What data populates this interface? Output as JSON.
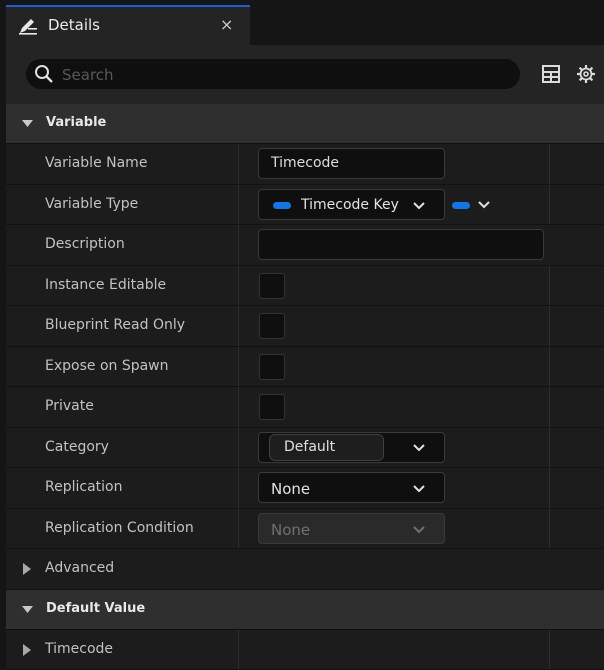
{
  "tab": {
    "title": "Details",
    "close": "×"
  },
  "search": {
    "placeholder": "Search",
    "value": ""
  },
  "sections": {
    "variable": "Variable",
    "default_value": "Default Value"
  },
  "rows": {
    "variable_name": {
      "label": "Variable Name",
      "value": "Timecode"
    },
    "variable_type": {
      "label": "Variable Type",
      "value": "Timecode Key",
      "pin_color": "#1476e6"
    },
    "description": {
      "label": "Description",
      "value": ""
    },
    "instance_editable": {
      "label": "Instance Editable",
      "checked": false
    },
    "blueprint_read_only": {
      "label": "Blueprint Read Only",
      "checked": false
    },
    "expose_on_spawn": {
      "label": "Expose on Spawn",
      "checked": false
    },
    "private": {
      "label": "Private",
      "checked": false
    },
    "category": {
      "label": "Category",
      "value": "Default"
    },
    "replication": {
      "label": "Replication",
      "value": "None"
    },
    "replication_condition": {
      "label": "Replication Condition",
      "value": "None",
      "disabled": true
    },
    "advanced": {
      "label": "Advanced"
    },
    "timecode": {
      "label": "Timecode"
    }
  },
  "colors": {
    "accent": "#1d5fd0",
    "pin_blue": "#1476e6"
  }
}
